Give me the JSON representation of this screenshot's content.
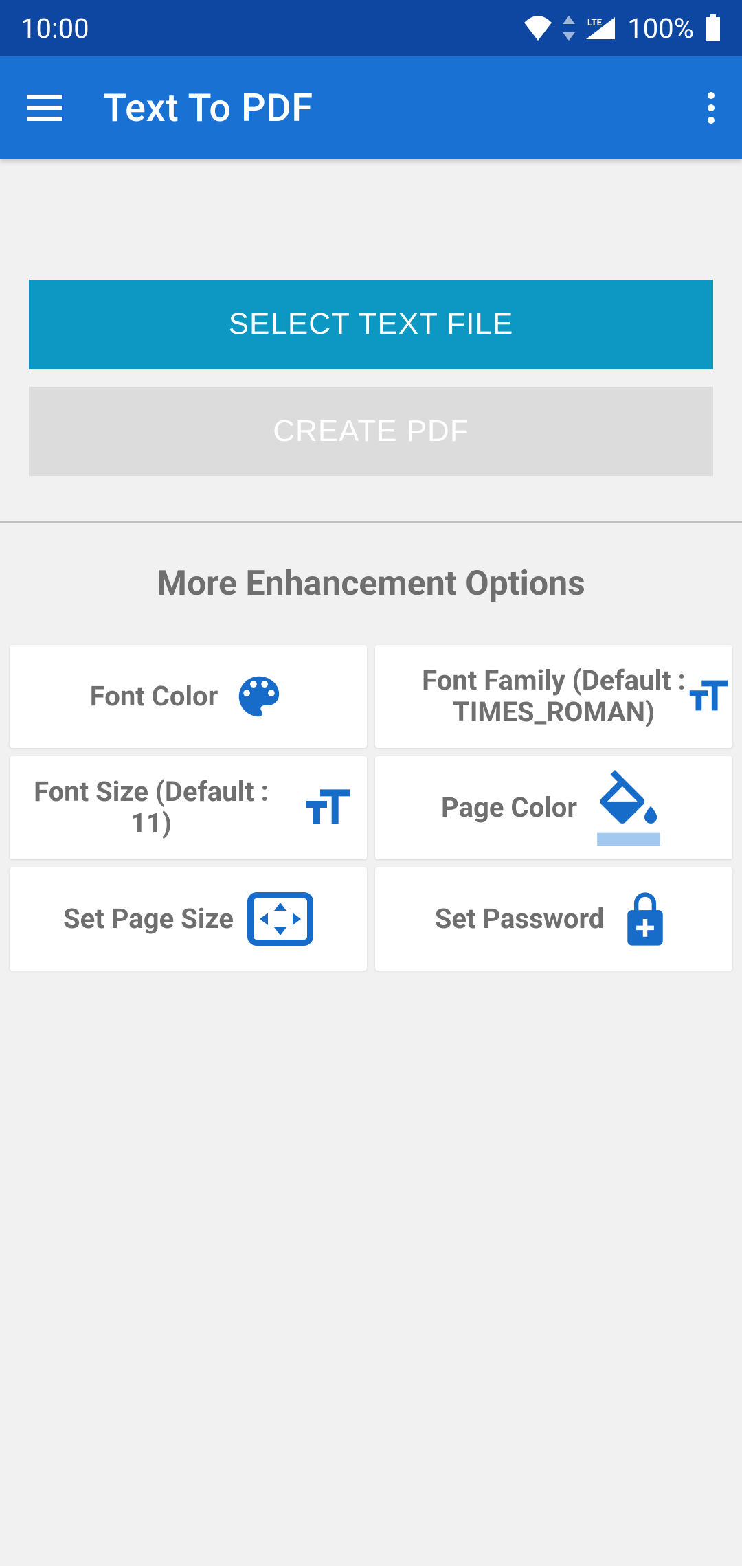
{
  "status": {
    "time": "10:00",
    "battery_pct": "100%",
    "network_label": "LTE"
  },
  "appbar": {
    "title": "Text To PDF"
  },
  "actions": {
    "select_file": "SELECT TEXT FILE",
    "create_pdf": "CREATE PDF"
  },
  "section": {
    "title": "More Enhancement Options"
  },
  "options": {
    "font_color": "Font Color",
    "font_family": "Font Family (Default : TIMES_ROMAN)",
    "font_size": "Font Size (Default : 11)",
    "page_color": "Page Color",
    "page_size": "Set Page Size",
    "password": "Set Password"
  },
  "colors": {
    "icon": "#176cc9",
    "icon_light": "#a2caf0"
  }
}
